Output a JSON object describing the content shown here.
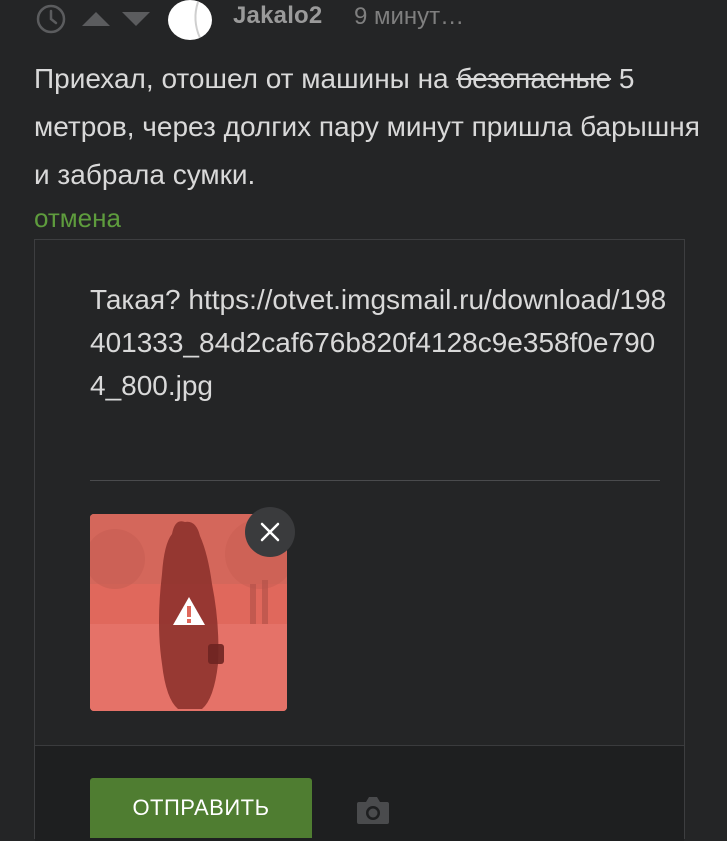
{
  "header": {
    "username": "Jakalo2",
    "timestamp": "9 минут…"
  },
  "comment": {
    "text_before": "Приехал, отошел от машины на ",
    "strikethrough": "безопасные",
    "text_after": " 5 метров, через долгих пару минут пришла барышня и забрала сумки."
  },
  "cancel_label": "отмена",
  "reply": {
    "text": "Такая? https://otvet.imgsmail.ru/download/198401333_84d2caf676b820f4128c9e358f0e7904_800.jpg",
    "attachment_status": "warning"
  },
  "footer": {
    "send_label": "ОТПРАВИТЬ"
  },
  "colors": {
    "background": "#242526",
    "accent_green": "#5e9c3d",
    "button_green": "#4f7d31",
    "thumb_overlay": "#e0685c"
  },
  "icons": [
    "clock-icon",
    "arrow-up-icon",
    "arrow-down-icon",
    "close-icon",
    "warning-icon",
    "camera-icon"
  ]
}
